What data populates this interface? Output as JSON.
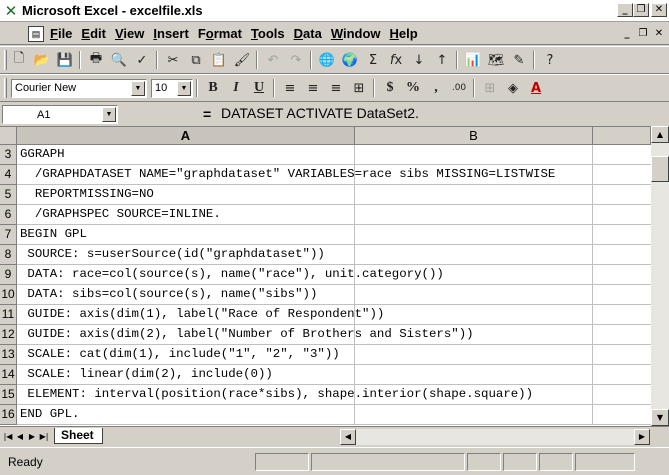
{
  "window": {
    "title": "Microsoft Excel - excelfile.xls"
  },
  "menu": {
    "items": [
      {
        "key": "F",
        "rest": "ile"
      },
      {
        "key": "E",
        "rest": "dit"
      },
      {
        "key": "V",
        "rest": "iew"
      },
      {
        "key": "I",
        "rest": "nsert"
      },
      {
        "key": "",
        "rest": "Format",
        "underline_index": 1
      },
      {
        "key": "T",
        "rest": "ools"
      },
      {
        "key": "D",
        "rest": "ata"
      },
      {
        "key": "W",
        "rest": "indow"
      },
      {
        "key": "H",
        "rest": "elp"
      }
    ]
  },
  "format_toolbar": {
    "font": "Courier New",
    "size": "10",
    "bold": "B",
    "italic": "I",
    "underline": "U",
    "currency": "$",
    "percent": "%",
    "comma": ","
  },
  "formula_bar": {
    "cell_ref": "A1",
    "equals": "=",
    "content": "DATASET ACTIVATE DataSet2."
  },
  "columns": [
    "A",
    "B",
    ""
  ],
  "rows": [
    {
      "num": "3",
      "text": "GGRAPH"
    },
    {
      "num": "4",
      "text": "  /GRAPHDATASET NAME=\"graphdataset\" VARIABLES=race sibs MISSING=LISTWISE"
    },
    {
      "num": "5",
      "text": "  REPORTMISSING=NO"
    },
    {
      "num": "6",
      "text": "  /GRAPHSPEC SOURCE=INLINE."
    },
    {
      "num": "7",
      "text": "BEGIN GPL"
    },
    {
      "num": "8",
      "text": " SOURCE: s=userSource(id(\"graphdataset\"))"
    },
    {
      "num": "9",
      "text": " DATA: race=col(source(s), name(\"race\"), unit.category())"
    },
    {
      "num": "10",
      "text": " DATA: sibs=col(source(s), name(\"sibs\"))"
    },
    {
      "num": "11",
      "text": " GUIDE: axis(dim(1), label(\"Race of Respondent\"))"
    },
    {
      "num": "12",
      "text": " GUIDE: axis(dim(2), label(\"Number of Brothers and Sisters\"))"
    },
    {
      "num": "13",
      "text": " SCALE: cat(dim(1), include(\"1\", \"2\", \"3\"))"
    },
    {
      "num": "14",
      "text": " SCALE: linear(dim(2), include(0))"
    },
    {
      "num": "15",
      "text": " ELEMENT: interval(position(race*sibs), shape.interior(shape.square))"
    },
    {
      "num": "16",
      "text": "END GPL."
    }
  ],
  "sheet_tab": {
    "label": "Sheet"
  },
  "status": {
    "text": "Ready"
  },
  "colors": {
    "face": "#d4d0c8",
    "grid": "#c0c0c0",
    "excel_green": "#1c6b2a"
  }
}
